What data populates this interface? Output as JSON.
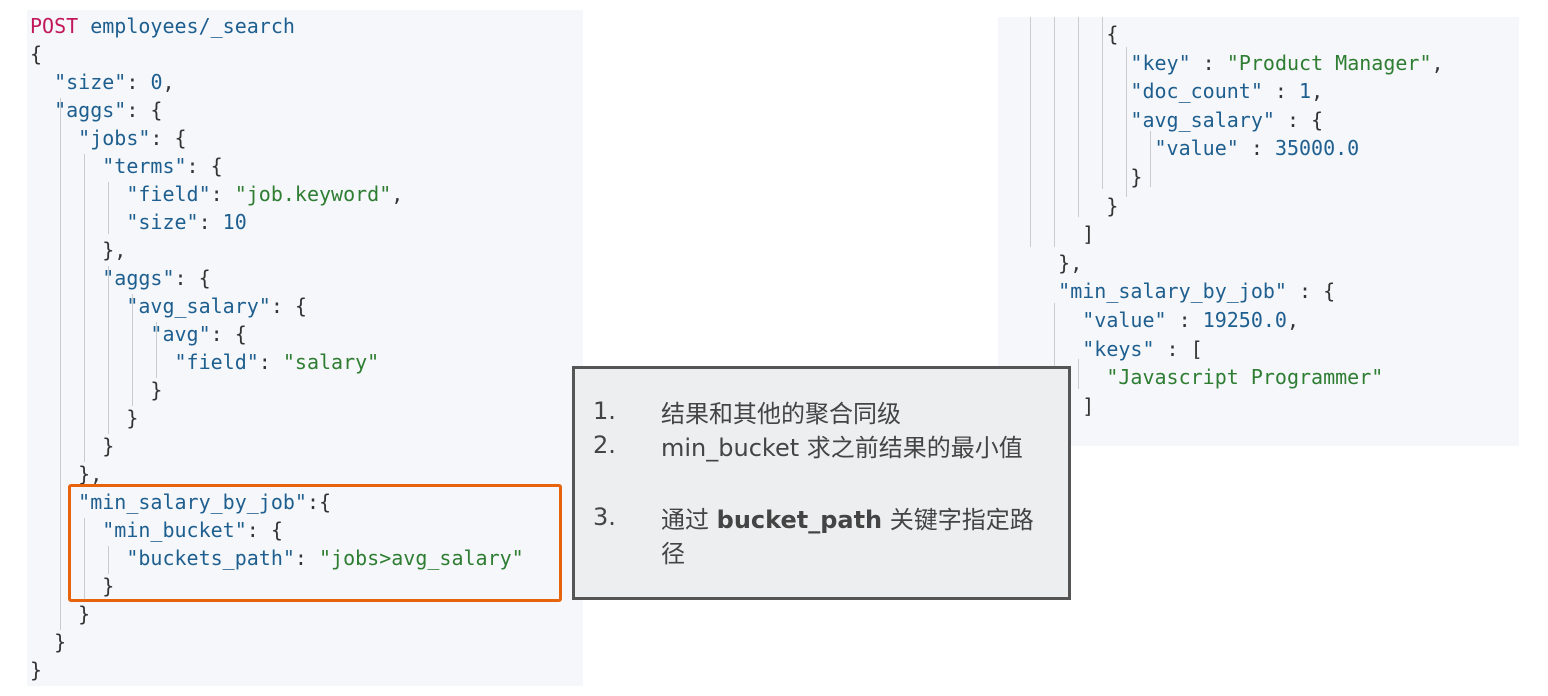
{
  "left_code": {
    "method": "POST",
    "endpoint": "employees/_search",
    "lines": [
      {
        "t": "{",
        "c": "p"
      },
      {
        "t": "  \"size\": 0,",
        "c": "k"
      },
      {
        "t": "  \"aggs\": {",
        "c": "k"
      },
      {
        "t": "    \"jobs\": {",
        "c": "k"
      },
      {
        "t": "      \"terms\": {",
        "c": "k"
      },
      {
        "t": "        \"field\": \"job.keyword\",",
        "c": "k"
      },
      {
        "t": "        \"size\": 10",
        "c": "k"
      },
      {
        "t": "      },",
        "c": "p"
      },
      {
        "t": "      \"aggs\": {",
        "c": "k"
      },
      {
        "t": "        \"avg_salary\": {",
        "c": "k"
      },
      {
        "t": "          \"avg\": {",
        "c": "k"
      },
      {
        "t": "            \"field\": \"salary\"",
        "c": "k"
      },
      {
        "t": "          }",
        "c": "p"
      },
      {
        "t": "        }",
        "c": "p"
      },
      {
        "t": "      }",
        "c": "p"
      },
      {
        "t": "    },",
        "c": "p"
      },
      {
        "t": "    \"min_salary_by_job\":{",
        "c": "k"
      },
      {
        "t": "      \"min_bucket\": {",
        "c": "k"
      },
      {
        "t": "        \"buckets_path\": \"jobs>avg_salary\"",
        "c": "k"
      },
      {
        "t": "      }",
        "c": "p"
      },
      {
        "t": "    }",
        "c": "p"
      },
      {
        "t": "  }",
        "c": "p"
      },
      {
        "t": "}",
        "c": "p"
      }
    ]
  },
  "right_code": {
    "lines": [
      {
        "t": "        {",
        "c": "p"
      },
      {
        "t": "          \"key\" : \"Product Manager\",",
        "c": "k"
      },
      {
        "t": "          \"doc_count\" : 1,",
        "c": "k"
      },
      {
        "t": "          \"avg_salary\" : {",
        "c": "k"
      },
      {
        "t": "            \"value\" : 35000.0",
        "c": "k"
      },
      {
        "t": "          }",
        "c": "p"
      },
      {
        "t": "        }",
        "c": "p"
      },
      {
        "t": "      ]",
        "c": "p"
      },
      {
        "t": "    },",
        "c": "p"
      },
      {
        "t": "    \"min_salary_by_job\" : {",
        "c": "k"
      },
      {
        "t": "      \"value\" : 19250.0,",
        "c": "k"
      },
      {
        "t": "      \"keys\" : [",
        "c": "k"
      },
      {
        "t": "        \"Javascript Programmer\"",
        "c": "s"
      },
      {
        "t": "      ]",
        "c": "p"
      }
    ]
  },
  "callout": {
    "items": [
      {
        "num": "1.",
        "text": "结果和其他的聚合同级"
      },
      {
        "num": "2.",
        "text": "min_bucket 求之前结果的最小值"
      },
      {
        "num": "3.",
        "pre": "通过 ",
        "bold": "bucket_path",
        "post": " 关键字指定路径"
      }
    ]
  },
  "colors": {
    "highlight_border": "#e8640c",
    "callout_border": "#555555",
    "panel_bg": "#f5f7fa",
    "key": "#1f5f8f",
    "string": "#2e7d32",
    "method": "#c2185b"
  }
}
